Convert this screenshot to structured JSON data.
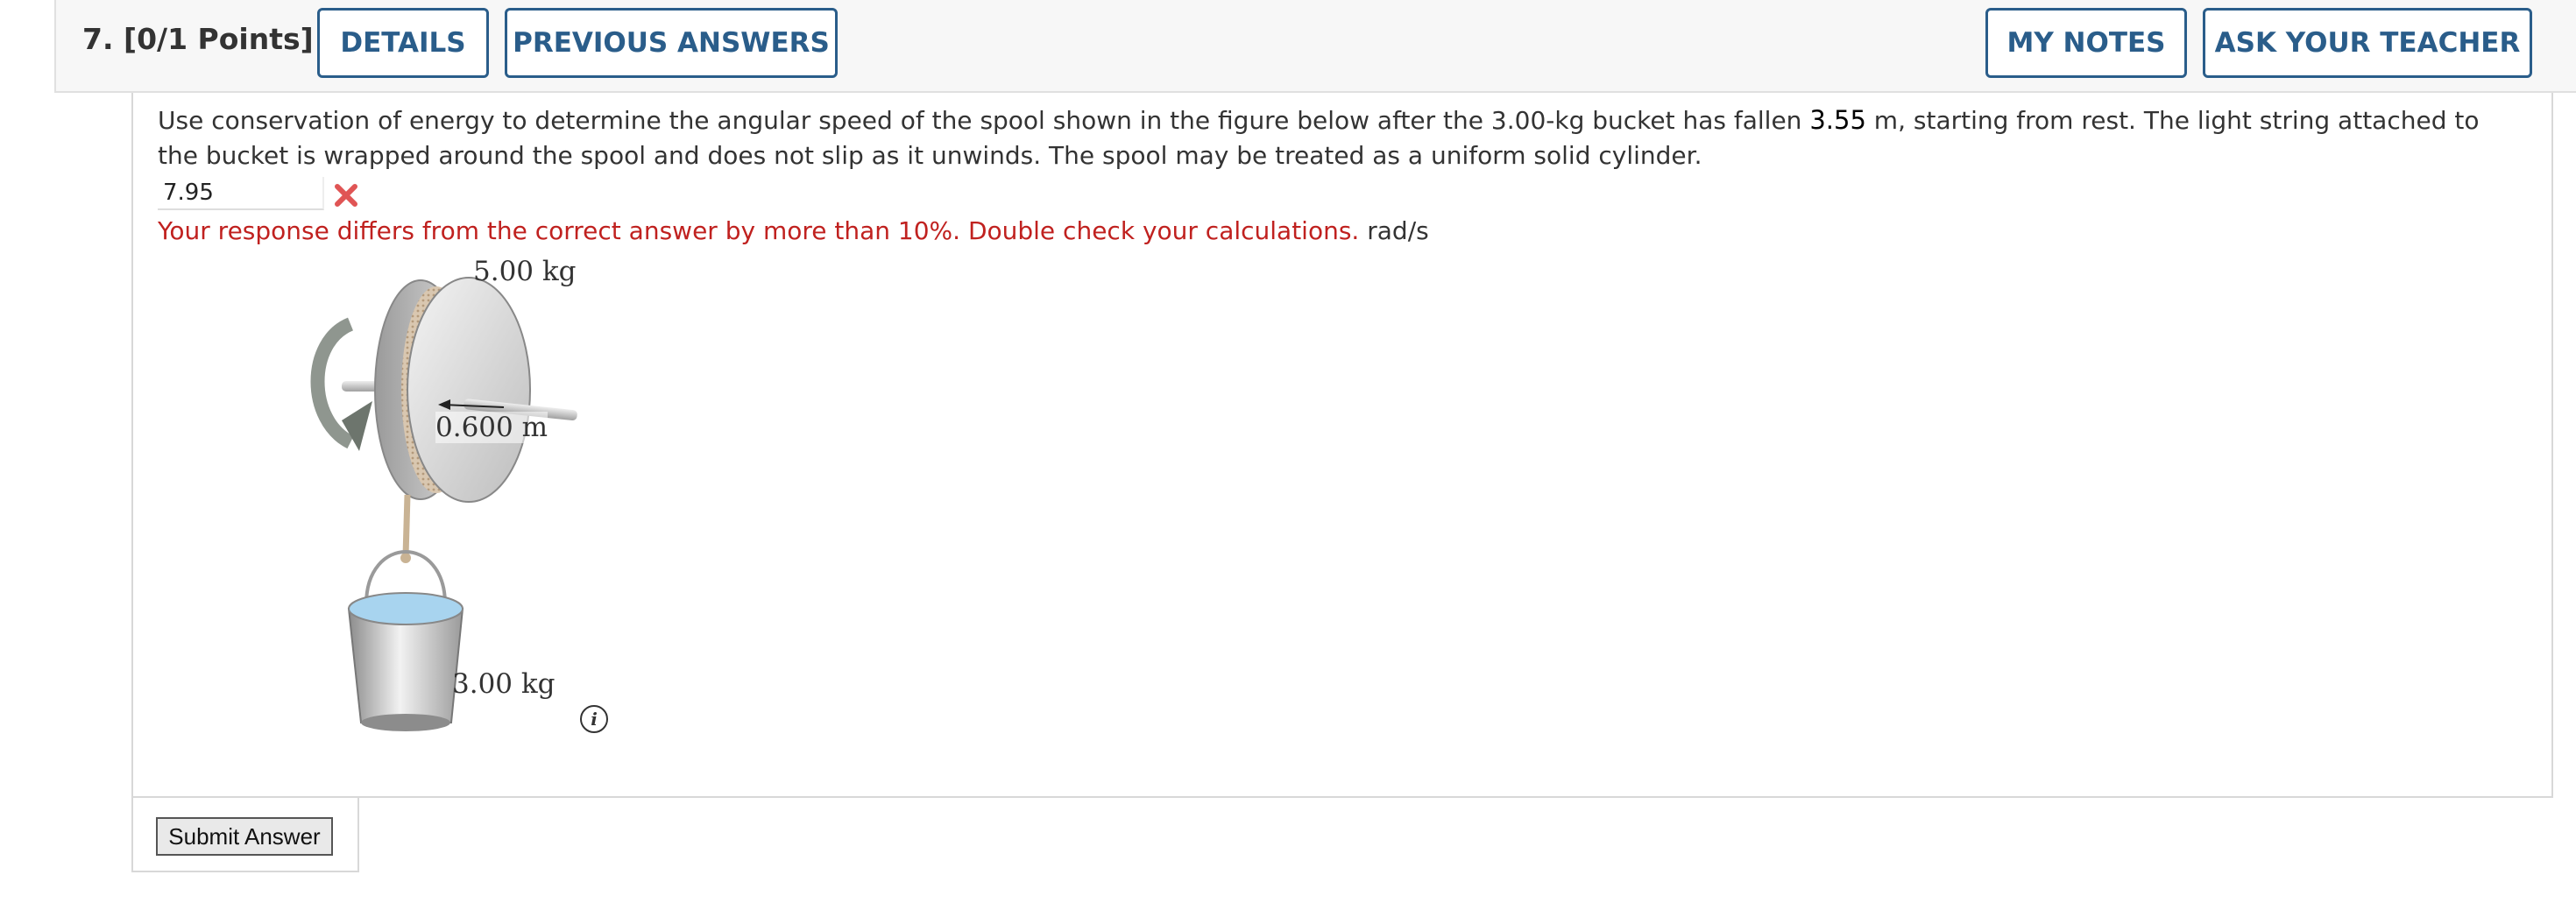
{
  "header": {
    "question_title": "7.  [0/1 Points]",
    "details_label": "DETAILS",
    "previous_answers_label": "PREVIOUS ANSWERS",
    "my_notes_label": "MY NOTES",
    "ask_teacher_label": "ASK YOUR TEACHER"
  },
  "question": {
    "text_part1": "Use conservation of energy to determine the angular speed of the spool shown in the figure below after the 3.00-kg bucket has fallen ",
    "distance_value": "3.55",
    "text_part2": " m, starting from rest. The light string attached to the bucket is wrapped around the spool and does not slip as it unwinds. The spool may be treated as a uniform solid cylinder."
  },
  "answer": {
    "value": "7.95",
    "status_icon": "wrong-x-icon",
    "feedback": "Your response differs from the correct answer by more than 10%. Double check your calculations.",
    "unit": "rad/s"
  },
  "figure": {
    "spool_mass_label": "5.00 kg",
    "radius_label": "0.600 m",
    "bucket_mass_label": "3.00 kg",
    "info_icon": "info-icon",
    "info_glyph": "i"
  },
  "footer": {
    "submit_label": "Submit Answer"
  },
  "colors": {
    "brand_blue": "#2a5d8a",
    "error_red": "#c0211f",
    "wrong_mark": "#e05555"
  }
}
